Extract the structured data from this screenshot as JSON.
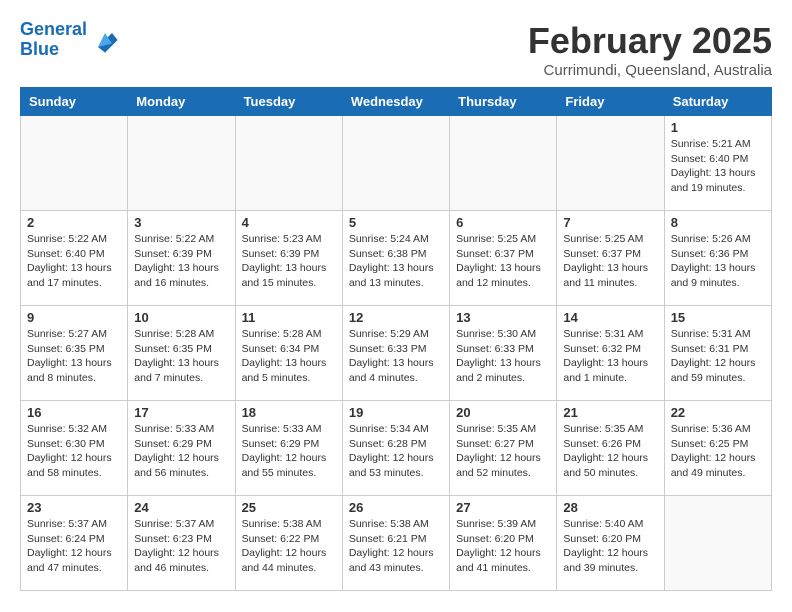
{
  "header": {
    "logo_line1": "General",
    "logo_line2": "Blue",
    "month_title": "February 2025",
    "location": "Currimundi, Queensland, Australia"
  },
  "weekdays": [
    "Sunday",
    "Monday",
    "Tuesday",
    "Wednesday",
    "Thursday",
    "Friday",
    "Saturday"
  ],
  "weeks": [
    [
      {
        "day": "",
        "info": ""
      },
      {
        "day": "",
        "info": ""
      },
      {
        "day": "",
        "info": ""
      },
      {
        "day": "",
        "info": ""
      },
      {
        "day": "",
        "info": ""
      },
      {
        "day": "",
        "info": ""
      },
      {
        "day": "1",
        "info": "Sunrise: 5:21 AM\nSunset: 6:40 PM\nDaylight: 13 hours\nand 19 minutes."
      }
    ],
    [
      {
        "day": "2",
        "info": "Sunrise: 5:22 AM\nSunset: 6:40 PM\nDaylight: 13 hours\nand 17 minutes."
      },
      {
        "day": "3",
        "info": "Sunrise: 5:22 AM\nSunset: 6:39 PM\nDaylight: 13 hours\nand 16 minutes."
      },
      {
        "day": "4",
        "info": "Sunrise: 5:23 AM\nSunset: 6:39 PM\nDaylight: 13 hours\nand 15 minutes."
      },
      {
        "day": "5",
        "info": "Sunrise: 5:24 AM\nSunset: 6:38 PM\nDaylight: 13 hours\nand 13 minutes."
      },
      {
        "day": "6",
        "info": "Sunrise: 5:25 AM\nSunset: 6:37 PM\nDaylight: 13 hours\nand 12 minutes."
      },
      {
        "day": "7",
        "info": "Sunrise: 5:25 AM\nSunset: 6:37 PM\nDaylight: 13 hours\nand 11 minutes."
      },
      {
        "day": "8",
        "info": "Sunrise: 5:26 AM\nSunset: 6:36 PM\nDaylight: 13 hours\nand 9 minutes."
      }
    ],
    [
      {
        "day": "9",
        "info": "Sunrise: 5:27 AM\nSunset: 6:35 PM\nDaylight: 13 hours\nand 8 minutes."
      },
      {
        "day": "10",
        "info": "Sunrise: 5:28 AM\nSunset: 6:35 PM\nDaylight: 13 hours\nand 7 minutes."
      },
      {
        "day": "11",
        "info": "Sunrise: 5:28 AM\nSunset: 6:34 PM\nDaylight: 13 hours\nand 5 minutes."
      },
      {
        "day": "12",
        "info": "Sunrise: 5:29 AM\nSunset: 6:33 PM\nDaylight: 13 hours\nand 4 minutes."
      },
      {
        "day": "13",
        "info": "Sunrise: 5:30 AM\nSunset: 6:33 PM\nDaylight: 13 hours\nand 2 minutes."
      },
      {
        "day": "14",
        "info": "Sunrise: 5:31 AM\nSunset: 6:32 PM\nDaylight: 13 hours\nand 1 minute."
      },
      {
        "day": "15",
        "info": "Sunrise: 5:31 AM\nSunset: 6:31 PM\nDaylight: 12 hours\nand 59 minutes."
      }
    ],
    [
      {
        "day": "16",
        "info": "Sunrise: 5:32 AM\nSunset: 6:30 PM\nDaylight: 12 hours\nand 58 minutes."
      },
      {
        "day": "17",
        "info": "Sunrise: 5:33 AM\nSunset: 6:29 PM\nDaylight: 12 hours\nand 56 minutes."
      },
      {
        "day": "18",
        "info": "Sunrise: 5:33 AM\nSunset: 6:29 PM\nDaylight: 12 hours\nand 55 minutes."
      },
      {
        "day": "19",
        "info": "Sunrise: 5:34 AM\nSunset: 6:28 PM\nDaylight: 12 hours\nand 53 minutes."
      },
      {
        "day": "20",
        "info": "Sunrise: 5:35 AM\nSunset: 6:27 PM\nDaylight: 12 hours\nand 52 minutes."
      },
      {
        "day": "21",
        "info": "Sunrise: 5:35 AM\nSunset: 6:26 PM\nDaylight: 12 hours\nand 50 minutes."
      },
      {
        "day": "22",
        "info": "Sunrise: 5:36 AM\nSunset: 6:25 PM\nDaylight: 12 hours\nand 49 minutes."
      }
    ],
    [
      {
        "day": "23",
        "info": "Sunrise: 5:37 AM\nSunset: 6:24 PM\nDaylight: 12 hours\nand 47 minutes."
      },
      {
        "day": "24",
        "info": "Sunrise: 5:37 AM\nSunset: 6:23 PM\nDaylight: 12 hours\nand 46 minutes."
      },
      {
        "day": "25",
        "info": "Sunrise: 5:38 AM\nSunset: 6:22 PM\nDaylight: 12 hours\nand 44 minutes."
      },
      {
        "day": "26",
        "info": "Sunrise: 5:38 AM\nSunset: 6:21 PM\nDaylight: 12 hours\nand 43 minutes."
      },
      {
        "day": "27",
        "info": "Sunrise: 5:39 AM\nSunset: 6:20 PM\nDaylight: 12 hours\nand 41 minutes."
      },
      {
        "day": "28",
        "info": "Sunrise: 5:40 AM\nSunset: 6:20 PM\nDaylight: 12 hours\nand 39 minutes."
      },
      {
        "day": "",
        "info": ""
      }
    ]
  ]
}
